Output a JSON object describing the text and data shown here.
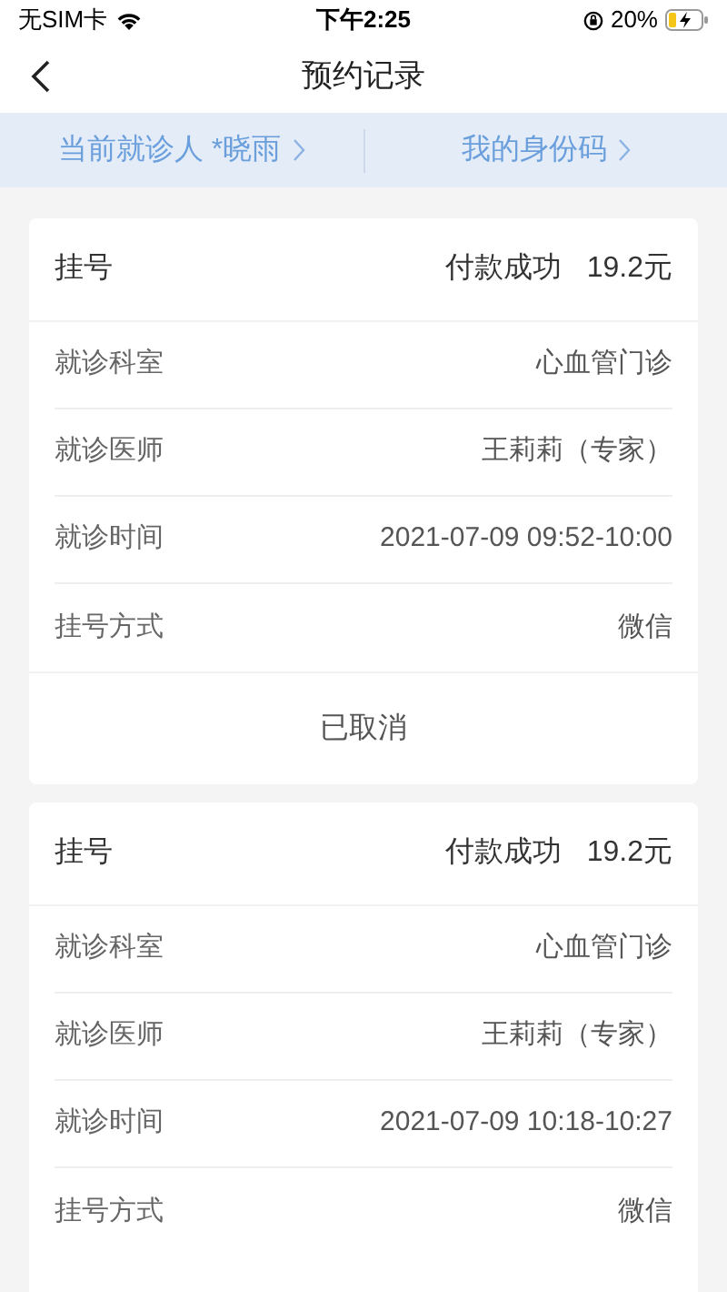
{
  "status_bar": {
    "carrier": "无SIM卡",
    "time": "下午2:25",
    "battery": "20%"
  },
  "nav": {
    "title": "预约记录"
  },
  "tabs": [
    {
      "label": "当前就诊人 *晓雨"
    },
    {
      "label": "我的身份码"
    }
  ],
  "records": [
    {
      "type": "挂号",
      "payment": "付款成功",
      "amount": "19.2元",
      "rows": [
        {
          "label": "就诊科室",
          "value": "心血管门诊"
        },
        {
          "label": "就诊医师",
          "value": "王莉莉（专家）"
        },
        {
          "label": "就诊时间",
          "value": "2021-07-09 09:52-10:00"
        },
        {
          "label": "挂号方式",
          "value": "微信"
        }
      ],
      "status": "已取消"
    },
    {
      "type": "挂号",
      "payment": "付款成功",
      "amount": "19.2元",
      "rows": [
        {
          "label": "就诊科室",
          "value": "心血管门诊"
        },
        {
          "label": "就诊医师",
          "value": "王莉莉（专家）"
        },
        {
          "label": "就诊时间",
          "value": "2021-07-09 10:18-10:27"
        },
        {
          "label": "挂号方式",
          "value": "微信"
        }
      ]
    }
  ]
}
